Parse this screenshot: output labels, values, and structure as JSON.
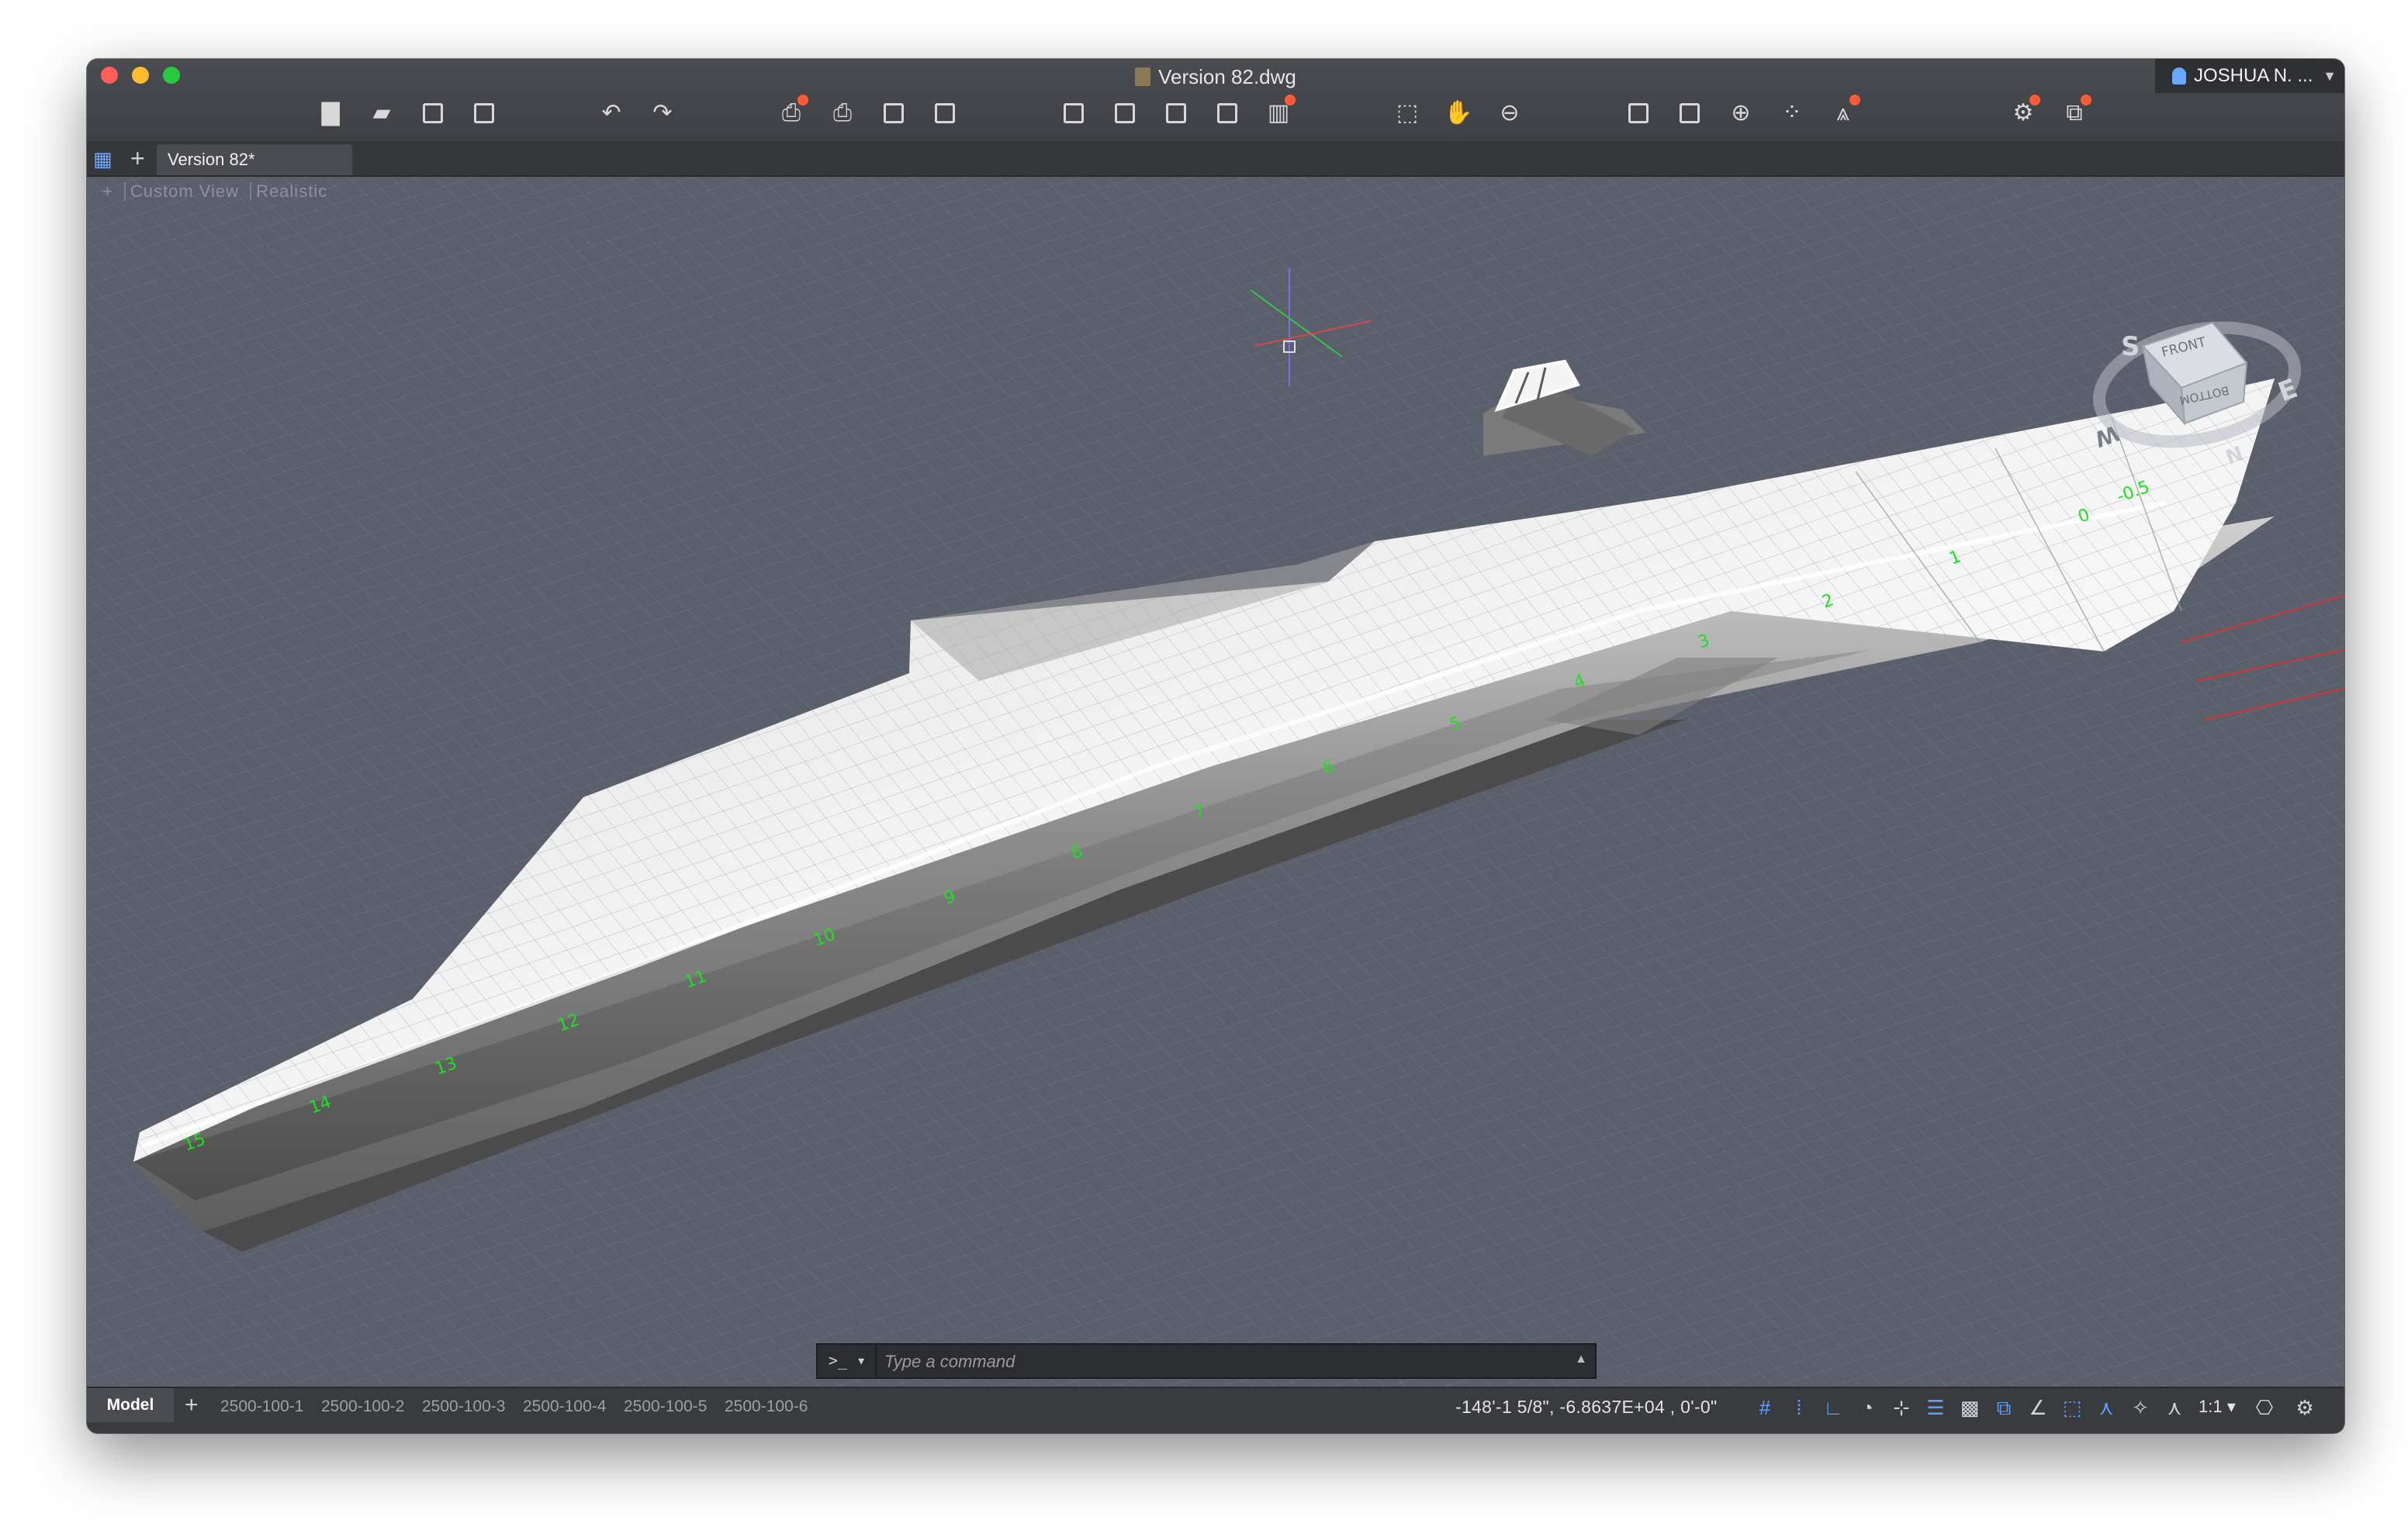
{
  "window": {
    "title": "Version 82.dwg",
    "user": "JOSHUA N. ..."
  },
  "toolbar": {
    "icons": [
      "new-file-icon",
      "open-folder-icon",
      "save-icon",
      "save-as-icon",
      "undo-icon",
      "redo-icon",
      "plot-icon",
      "print-icon",
      "publish-icon",
      "batch-plot-icon",
      "import-icon",
      "export-icon",
      "attach-icon",
      "xref-icon",
      "share-icon",
      "zoom-window-icon",
      "pan-icon",
      "orbit-icon",
      "properties-icon",
      "layer-icon",
      "insert-block-icon",
      "group-icon",
      "quick-measure-icon",
      "renderer-icon",
      "visual-style-icon"
    ]
  },
  "tabs": {
    "document": "Version 82*"
  },
  "viewport": {
    "controls": {
      "view": "Custom View",
      "style": "Realistic"
    },
    "viewcube": {
      "top_face": "FRONT",
      "side_face": "BOTTOM",
      "compass": [
        "S",
        "E",
        "N",
        "W"
      ]
    },
    "hull_labels": [
      "15",
      "14",
      "13",
      "12",
      "11",
      "10",
      "9",
      "8",
      "7",
      "6",
      "5",
      "4",
      "3",
      "2",
      "1",
      "0",
      "-0.5"
    ],
    "colors": {
      "background": "#5b5e6b",
      "grid_line": "#6c707d",
      "hull_light": "#f2f2f2",
      "hull_dark": "#6a6a6a",
      "label_green": "#22dd22",
      "axis_red": "#d23535"
    }
  },
  "command": {
    "prompt": ">_",
    "placeholder": "Type a command"
  },
  "status": {
    "layouts": [
      "Model",
      "2500-100-1",
      "2500-100-2",
      "2500-100-3",
      "2500-100-4",
      "2500-100-5",
      "2500-100-6"
    ],
    "coordinates": "-148'-1 5/8\", -6.8637E+04 , 0'-0\"",
    "scale": "1:1"
  }
}
